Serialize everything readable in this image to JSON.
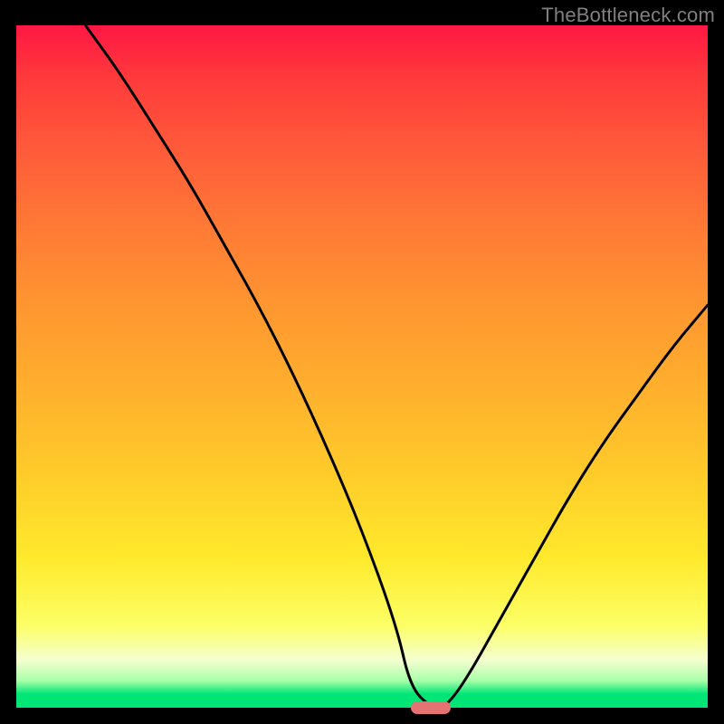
{
  "watermark": "TheBottleneck.com",
  "chart_data": {
    "type": "line",
    "title": "",
    "xlabel": "",
    "ylabel": "",
    "xlim": [
      0,
      100
    ],
    "ylim": [
      0,
      100
    ],
    "background_gradient": {
      "top": "#ff1744",
      "bottom": "#00e676"
    },
    "series": [
      {
        "name": "bottleneck-curve",
        "x": [
          10,
          15,
          20,
          25,
          30,
          35,
          40,
          45,
          50,
          55,
          57,
          60,
          62,
          65,
          70,
          75,
          80,
          85,
          90,
          95,
          100
        ],
        "y": [
          100,
          93,
          85,
          77,
          68,
          59,
          49,
          38,
          26,
          12,
          3,
          0,
          0,
          4,
          13,
          22,
          31,
          39,
          46,
          53,
          59
        ]
      }
    ],
    "marker": {
      "x": 60,
      "y": 0,
      "color": "#e57373"
    }
  }
}
